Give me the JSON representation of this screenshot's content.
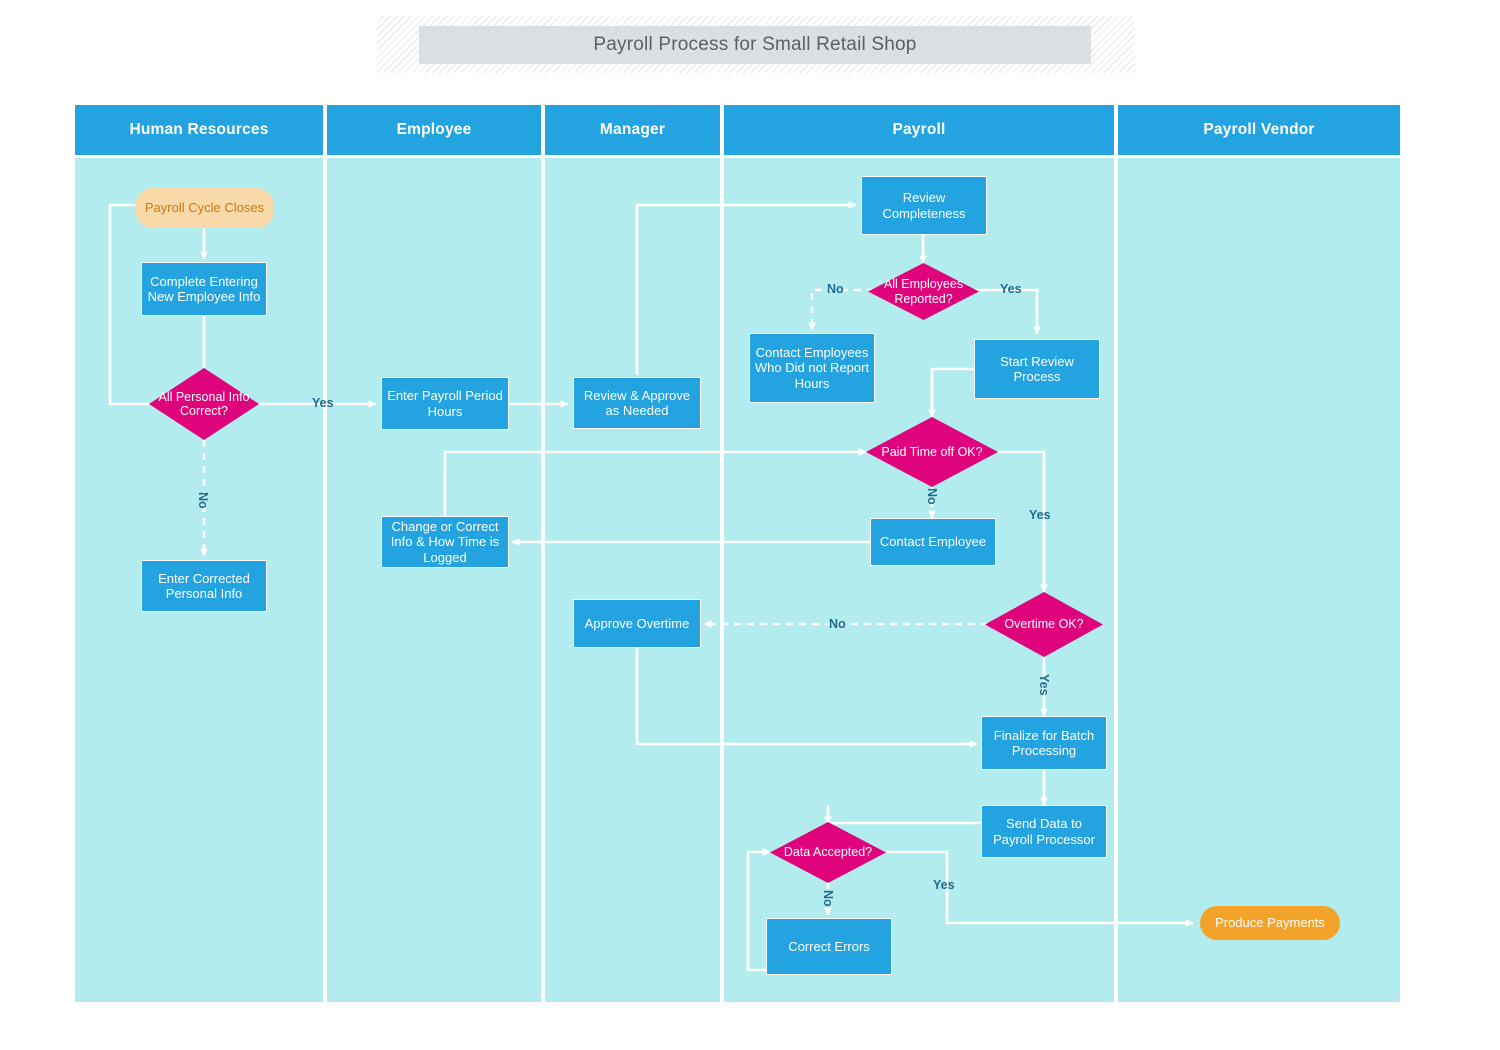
{
  "title": "Payroll Process for Small Retail Shop",
  "colors": {
    "lane_header": "#23A3E0",
    "lane_body": "#B2ECEF",
    "process": "#23A3E0",
    "decision": "#E0047C",
    "terminator_start": "#FAD9A8",
    "terminator_end": "#F4A32A",
    "connector": "#FFFFFF",
    "edge_label": "#1F6C91",
    "title_text": "#5C6066"
  },
  "lanes": [
    {
      "id": "hr",
      "label": "Human Resources"
    },
    {
      "id": "emp",
      "label": "Employee"
    },
    {
      "id": "mgr",
      "label": "Manager"
    },
    {
      "id": "pay",
      "label": "Payroll"
    },
    {
      "id": "vendor",
      "label": "Payroll Vendor"
    }
  ],
  "nodes": {
    "payroll_cycle_closes": {
      "label": "Payroll Cycle Closes",
      "type": "terminator",
      "lane": "hr"
    },
    "complete_entering": {
      "label": "Complete Entering New Employee Info",
      "type": "process",
      "lane": "hr"
    },
    "all_personal_correct": {
      "label": "All Personal Info Correct?",
      "type": "decision",
      "lane": "hr"
    },
    "enter_corrected": {
      "label": "Enter Corrected Personal Info",
      "type": "process",
      "lane": "hr"
    },
    "enter_payroll_hours": {
      "label": "Enter Payroll Period Hours",
      "type": "process",
      "lane": "emp"
    },
    "change_or_correct": {
      "label": "Change or Correct Info & How Time is Logged",
      "type": "process",
      "lane": "emp"
    },
    "review_approve": {
      "label": "Review & Approve as Needed",
      "type": "process",
      "lane": "mgr"
    },
    "approve_overtime": {
      "label": "Approve Overtime",
      "type": "process",
      "lane": "mgr"
    },
    "review_completeness": {
      "label": "Review Completeness",
      "type": "process",
      "lane": "pay"
    },
    "all_employees_reported": {
      "label": "All Employees Reported?",
      "type": "decision",
      "lane": "pay"
    },
    "contact_employees": {
      "label": "Contact Employees Who Did not Report Hours",
      "type": "process",
      "lane": "pay"
    },
    "start_review_process": {
      "label": "Start Review Process",
      "type": "process",
      "lane": "pay"
    },
    "paid_time_off_ok": {
      "label": "Paid Time off OK?",
      "type": "decision",
      "lane": "pay"
    },
    "contact_employee": {
      "label": "Contact Employee",
      "type": "process",
      "lane": "pay"
    },
    "overtime_ok": {
      "label": "Overtime OK?",
      "type": "decision",
      "lane": "pay"
    },
    "finalize_batch": {
      "label": "Finalize for Batch Processing",
      "type": "process",
      "lane": "pay"
    },
    "send_data": {
      "label": "Send Data to Payroll Processor",
      "type": "process",
      "lane": "pay"
    },
    "data_accepted": {
      "label": "Data Accepted?",
      "type": "decision",
      "lane": "pay"
    },
    "correct_errors": {
      "label": "Correct Errors",
      "type": "process",
      "lane": "pay"
    },
    "produce_payments": {
      "label": "Produce Payments",
      "type": "terminator",
      "lane": "vendor"
    }
  },
  "edge_labels": {
    "personal_yes": "Yes",
    "personal_no": "No",
    "reported_no": "No",
    "reported_yes": "Yes",
    "pto_no": "No",
    "pto_yes": "Yes",
    "overtime_no": "No",
    "overtime_yes": "Yes",
    "data_no": "No",
    "data_yes": "Yes"
  }
}
